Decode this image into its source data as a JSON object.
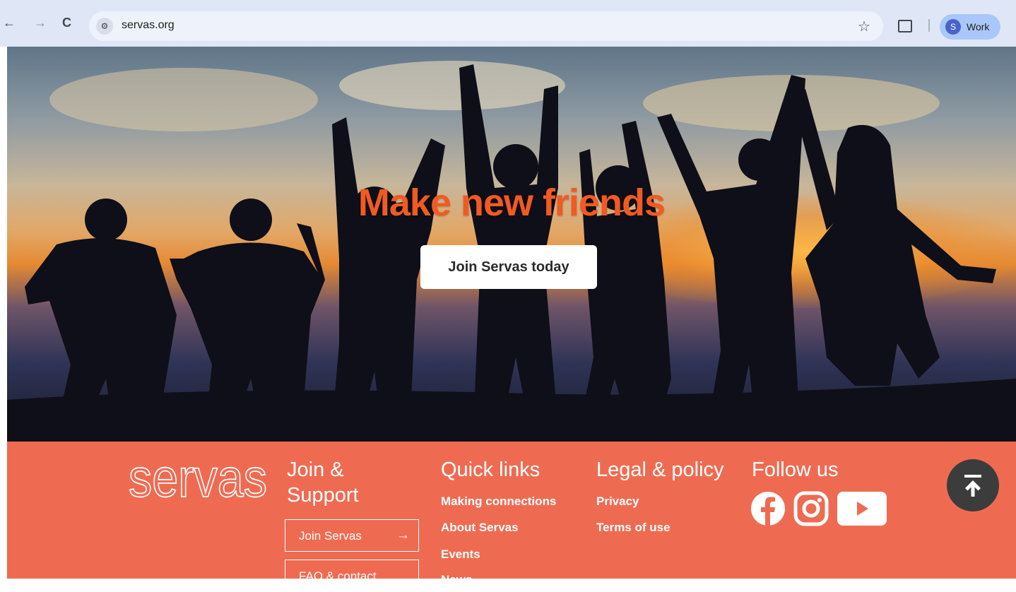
{
  "browser": {
    "url": "servas.org",
    "profile_initial": "S",
    "profile_label": "Work"
  },
  "hero": {
    "headline": "Make new friends",
    "cta_label": "Join Servas today"
  },
  "footer": {
    "logo_text": "servas",
    "join_support": {
      "title_line1": "Join &",
      "title_line2": "Support",
      "buttons": [
        "Join Servas",
        "FAQ & contact"
      ]
    },
    "quick_links": {
      "title": "Quick links",
      "items": [
        "Making connections",
        "About Servas",
        "Events",
        "News"
      ]
    },
    "legal": {
      "title": "Legal & policy",
      "items": [
        "Privacy",
        "Terms of use"
      ]
    },
    "follow": {
      "title": "Follow us",
      "icons": [
        "facebook-icon",
        "instagram-icon",
        "youtube-icon"
      ]
    }
  },
  "colors": {
    "brand_orange": "#ee6b52",
    "headline_orange": "#f15a22"
  }
}
